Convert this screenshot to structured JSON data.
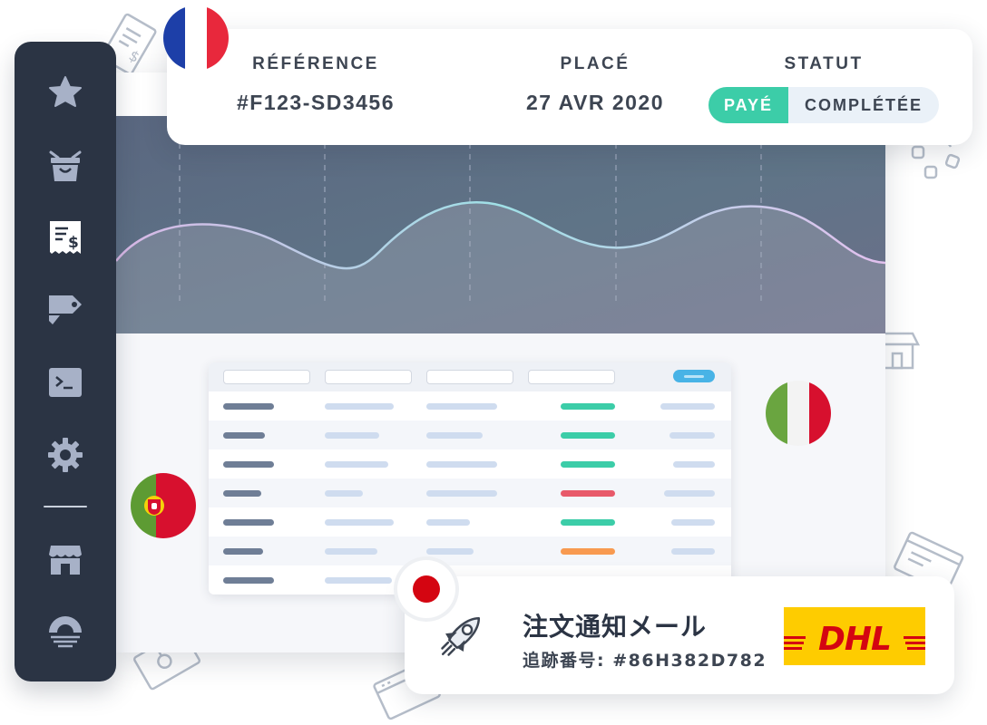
{
  "sidebar": {
    "items": [
      {
        "icon": "star-icon"
      },
      {
        "icon": "basket-icon"
      },
      {
        "icon": "receipt-icon"
      },
      {
        "icon": "tag-icon"
      },
      {
        "icon": "terminal-icon"
      },
      {
        "icon": "gear-icon"
      },
      {
        "icon": "store-icon"
      },
      {
        "icon": "life-ring-icon"
      }
    ],
    "colors": {
      "background": "#2b3444",
      "icon": "#a7b1c7",
      "active_icon": "#ffffff"
    }
  },
  "order": {
    "labels": {
      "reference": "RÉFÉRENCE",
      "placed": "PLACÉ",
      "status": "STATUT"
    },
    "reference": "#F123-SD3456",
    "placed": "27 AVR 2020",
    "status_paid": "PAYÉ",
    "status_completed": "COMPLÉTÉE",
    "flag": "france-flag"
  },
  "notification": {
    "title": "注文通知メール",
    "tracking": "追跡番号: #86H382D782",
    "carrier_logo": "DHL",
    "flag": "japan-flag",
    "icon": "rocket-icon"
  },
  "flags": [
    "france-flag",
    "italy-flag",
    "portugal-flag",
    "japan-flag"
  ],
  "table": {
    "status_colors": [
      "#3ccda8",
      "#3ccda8",
      "#3ccda8",
      "#e85a6a",
      "#3ccda8",
      "#f89a50"
    ]
  },
  "colors": {
    "accent": "#3ccda8",
    "brand_dark": "#2b3444",
    "dhl_yellow": "#fecc00",
    "dhl_red": "#d40511"
  }
}
